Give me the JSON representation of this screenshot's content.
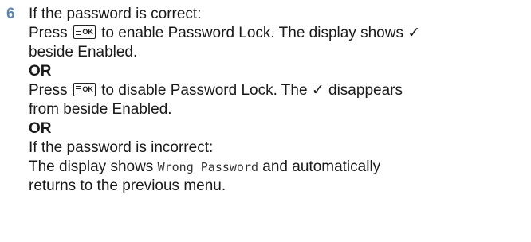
{
  "step": {
    "number": "6",
    "intro": "If the password is correct:",
    "press_1": "Press",
    "text_1a": "to enable Password Lock. The display shows ✓",
    "text_1b": "beside Enabled.",
    "or_1": "OR",
    "press_2": "Press",
    "text_2a": "to disable Password Lock. The ✓ disappears",
    "text_2b": "from beside Enabled.",
    "or_2": "OR",
    "incorrect": "If the password is incorrect:",
    "text_3a_pre": "The display shows",
    "wrong_password": "Wrong Password",
    "text_3a_post": "and automatically",
    "text_3b": "returns to the previous menu.",
    "ok_key_label": "OK",
    "ok_key_icon": "menu-ok-key-icon"
  }
}
